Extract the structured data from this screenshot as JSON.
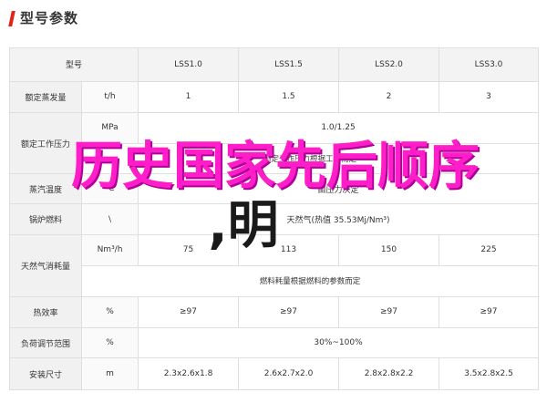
{
  "header": {
    "title": "型号参数"
  },
  "colors": {
    "accent": "#e2231a",
    "overlay_pink": "#ff1ec8",
    "overlay_dark": "#1a1a1a"
  },
  "table": {
    "col_headers": [
      "型号",
      "LSS1.0",
      "LSS1.5",
      "LSS2.0",
      "LSS3.0"
    ],
    "rows": {
      "rated_steam": {
        "label": "额定蒸发量",
        "unit": "t/h",
        "values": [
          "1",
          "1.5",
          "2",
          "3"
        ]
      },
      "rated_pressure": {
        "label": "额定工作压力",
        "unit": "MPa",
        "value": "1.0/1.25",
        "note": "额定工作压力根据工况而定"
      },
      "steam_temp": {
        "label": "蒸汽温度",
        "unit": "℃",
        "value": "由压力决定"
      },
      "fuel": {
        "label": "锅炉燃料",
        "unit": "\\",
        "value": "天然气(热值 35.53Mj/Nm³)"
      },
      "gas_consumption": {
        "label": "天然气消耗量",
        "unit": "Nm³/h",
        "values": [
          "75",
          "113",
          "150",
          "225"
        ],
        "note": "燃料耗量根据燃料的参数而定"
      },
      "efficiency": {
        "label": "热效率",
        "unit": "%",
        "values": [
          "≥97",
          "≥97",
          "≥97",
          "≥97"
        ]
      },
      "load_range": {
        "label": "负荷调节范围",
        "unit": "%",
        "value": "30%~100%"
      },
      "size": {
        "label": "安装尺寸",
        "unit": "m",
        "values": [
          "2.3x2.6x1.8",
          "2.6x2.7x2.0",
          "2.8x2.8x2.2",
          "3.5x2.8x2.5"
        ]
      }
    }
  },
  "overlay": {
    "line1": "历史国家先后顺序",
    "line2": ",明"
  }
}
